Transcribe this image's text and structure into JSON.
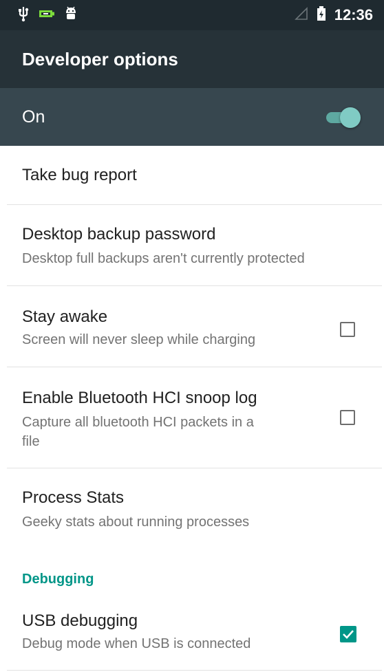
{
  "status_bar": {
    "time": "12:36",
    "icons": [
      "usb-icon",
      "battery-charging-icon",
      "android-debug-icon",
      "no-signal-icon",
      "battery-icon"
    ]
  },
  "toolbar": {
    "title": "Developer options"
  },
  "master_switch": {
    "label": "On",
    "state": "on"
  },
  "items": {
    "bug_report": {
      "title": "Take bug report"
    },
    "backup_password": {
      "title": "Desktop backup password",
      "summary": "Desktop full backups aren't currently protected"
    },
    "stay_awake": {
      "title": "Stay awake",
      "summary": "Screen will never sleep while charging",
      "checked": false
    },
    "bt_snoop": {
      "title": "Enable Bluetooth HCI snoop log",
      "summary_line1": "Capture all bluetooth HCI packets in a",
      "summary_line2": "file",
      "checked": false
    },
    "process_stats": {
      "title": "Process Stats",
      "summary": "Geeky stats about running processes"
    }
  },
  "debugging": {
    "header": "Debugging",
    "usb_debugging": {
      "title": "USB debugging",
      "summary": "Debug mode when USB is connected",
      "checked": true
    }
  },
  "colors": {
    "status_bar": "#1f2a30",
    "toolbar": "#263238",
    "master_switch_bar": "#37474f",
    "accent": "#009688"
  }
}
